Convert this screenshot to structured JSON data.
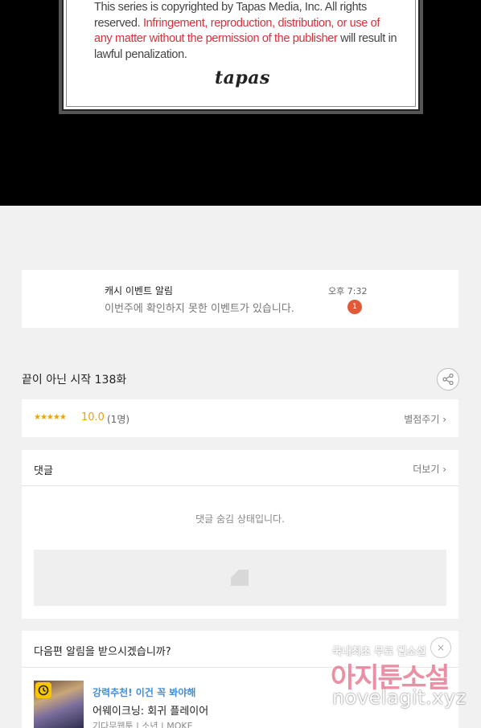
{
  "comic": {
    "copyright_line1": "This series is copyrighted by Tapas Media, Inc. All rights",
    "copyright_line2a": "reserved. ",
    "copyright_line2b": "Infringement, reproduction, distribution, or use of",
    "copyright_line3a": "any matter without the permission of the publisher",
    "copyright_line3b": " will result in",
    "copyright_line4": "lawful penalization.",
    "logo": "tapas"
  },
  "notification": {
    "title": "캐시 이벤트 알림",
    "message": "이번주에 확인하지 못한 이벤트가 있습니다.",
    "time": "오후 7:32",
    "badge": "1"
  },
  "episode": {
    "title": "끝이 아닌 시작 138화",
    "share_icon": "share-icon"
  },
  "rating": {
    "stars": "★★★★★",
    "score": "10.0",
    "count": "(1명)",
    "rate_link": "별점주기 ›",
    "star_color": "#f0a100"
  },
  "comments": {
    "title": "댓글",
    "more_link": "더보기 ›",
    "hidden_message": "댓글 숨김 상태입니다."
  },
  "next_episode": {
    "question": "다음편 알림을 받으시겠습니까?",
    "close": "×",
    "rec_tag": "강력추천! 이건 꼭 봐야해",
    "rec_title": "어웨이크닝: 회귀 플레이어",
    "rec_meta": "기다무웹툰 | 소년 | MOKE",
    "tag_color": "#3e8ee0"
  },
  "watermark": {
    "line1": "국내최초 무료 웹소설",
    "line2": "아지툰소설",
    "line3": "novelagit.xyz"
  }
}
